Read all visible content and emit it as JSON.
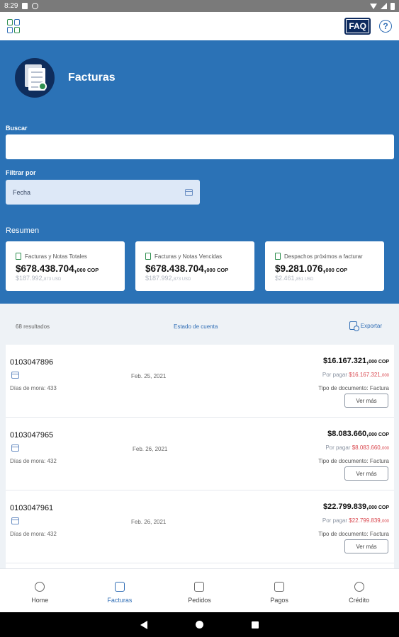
{
  "status_bar": {
    "time": "8:29"
  },
  "app_bar": {
    "faq_label": "FAQ",
    "help_glyph": "?"
  },
  "header": {
    "title": "Facturas"
  },
  "search": {
    "label": "Buscar",
    "value": "",
    "placeholder": ""
  },
  "filter": {
    "label": "Filtrar por",
    "selected": "Fecha"
  },
  "summary": {
    "title": "Resumen",
    "cards": [
      {
        "label": "Facturas y Notas Totales",
        "amount": "$678.438.704,",
        "amount_suffix": "000 COP",
        "secondary": "$187.992,",
        "secondary_suffix": "873 USD"
      },
      {
        "label": "Facturas y Notas Vencidas",
        "amount": "$678.438.704,",
        "amount_suffix": "000 COP",
        "secondary": "$187.992,",
        "secondary_suffix": "873 USD"
      },
      {
        "label": "Despachos próximos a facturar",
        "amount": "$9.281.076,",
        "amount_suffix": "000 COP",
        "secondary": "$2.461,",
        "secondary_suffix": "851 USD"
      }
    ]
  },
  "toolbar": {
    "results": "68 resultados",
    "statement_link": "Estado de cuenta",
    "export_label": "Exportar"
  },
  "invoices": [
    {
      "number": "0103047896",
      "date": "Feb. 25, 2021",
      "overdue": "Días de mora: 433",
      "amount": "$16.167.321,",
      "amount_suffix": "000 COP",
      "due_label": "Por pagar",
      "due_amount": "$16.167.321,",
      "due_suffix": "000",
      "doc_type": "Tipo de documento: Factura",
      "button": "Ver más"
    },
    {
      "number": "0103047965",
      "date": "Feb. 26, 2021",
      "overdue": "Días de mora: 432",
      "amount": "$8.083.660,",
      "amount_suffix": "000 COP",
      "due_label": "Por pagar",
      "due_amount": "$8.083.660,",
      "due_suffix": "000",
      "doc_type": "Tipo de documento: Factura",
      "button": "Ver más"
    },
    {
      "number": "0103047961",
      "date": "Feb. 26, 2021",
      "overdue": "Días de mora: 432",
      "amount": "$22.799.839,",
      "amount_suffix": "000 COP",
      "due_label": "Por pagar",
      "due_amount": "$22.799.839,",
      "due_suffix": "000",
      "doc_type": "Tipo de documento: Factura",
      "button": "Ver más"
    }
  ],
  "bottom_nav": [
    {
      "label": "Home",
      "icon": "home-hand-icon",
      "active": false
    },
    {
      "label": "Facturas",
      "icon": "invoice-chart-icon",
      "active": true
    },
    {
      "label": "Pedidos",
      "icon": "orders-icon",
      "active": false
    },
    {
      "label": "Pagos",
      "icon": "payments-icon",
      "active": false
    },
    {
      "label": "Crédito",
      "icon": "credit-gauge-icon",
      "active": false
    }
  ],
  "colors": {
    "primary": "#2b72b6",
    "dark_navy": "#0f2d5c",
    "accent_green": "#2f8f4f",
    "due_red": "#d9484f",
    "background": "#eef2f6"
  }
}
